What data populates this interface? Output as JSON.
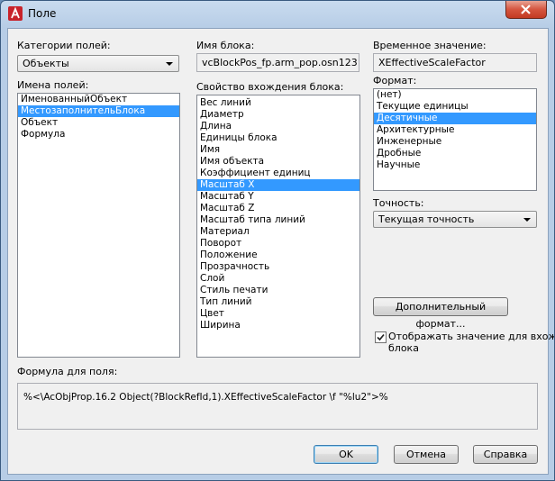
{
  "window": {
    "title": "Поле"
  },
  "field_categories": {
    "label": "Категории полей:",
    "selected": "Объекты"
  },
  "field_names": {
    "label": "Имена полей:",
    "items": [
      "ИменованныйОбъект",
      "МестозаполнительБлока",
      "Объект",
      "Формула"
    ],
    "selected_index": 1
  },
  "block_name": {
    "label": "Имя блока:",
    "value": "vcBlockPos_fp.arm_pop.osn123"
  },
  "block_property": {
    "label": "Свойство вхождения блока:",
    "items": [
      "Вес линий",
      "Диаметр",
      "Длина",
      "Единицы блока",
      "Имя",
      "Имя объекта",
      "Коэффициент единиц",
      "Масштаб X",
      "Масштаб Y",
      "Масштаб Z",
      "Масштаб типа линий",
      "Материал",
      "Поворот",
      "Положение",
      "Прозрачность",
      "Слой",
      "Стиль печати",
      "Тип линий",
      "Цвет",
      "Ширина"
    ],
    "selected_index": 7
  },
  "temp_value": {
    "label": "Временное значение:",
    "value": "XEffectiveScaleFactor"
  },
  "format": {
    "label": "Формат:",
    "items": [
      "(нет)",
      "Текущие единицы",
      "Десятичные",
      "Архитектурные",
      "Инженерные",
      "Дробные",
      "Научные"
    ],
    "selected_index": 2
  },
  "precision": {
    "label": "Точность:",
    "selected": "Текущая точность"
  },
  "extra_format_button": "Дополнительный формат...",
  "display_value_checkbox": {
    "label_line1": "Отображать значение для вхожд",
    "label_line2": "блока",
    "checked": true
  },
  "formula": {
    "label": "Формула для поля:",
    "value": "%<\\AcObjProp.16.2 Object(?BlockRefId,1).XEffectiveScaleFactor \\f \"%lu2\">%"
  },
  "buttons": {
    "ok": "OK",
    "cancel": "Отмена",
    "help": "Справка"
  },
  "icons": {
    "app": "autocad-a-icon",
    "close": "close-x-icon",
    "check": "checkmark-icon",
    "dropdown": "chevron-down-icon"
  }
}
